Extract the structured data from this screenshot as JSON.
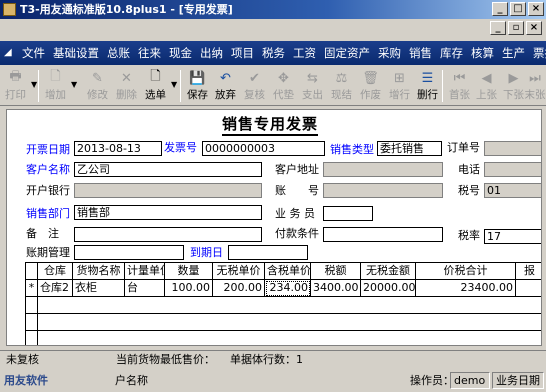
{
  "window": {
    "title": "T3-用友通标准版10.8plus1 - [专用发票]"
  },
  "menu": [
    "文件",
    "基础设置",
    "总账",
    "往来",
    "现金",
    "出纳",
    "项目",
    "税务",
    "工资",
    "固定资产",
    "采购",
    "销售",
    "库存",
    "核算",
    "生产",
    "票据"
  ],
  "toolbar": {
    "print": "打印",
    "add": "增加",
    "modify": "修改",
    "delete": "删除",
    "select_doc": "选单",
    "save": "保存",
    "abandon": "放弃",
    "review": "复核",
    "voucher": "代垫",
    "payment": "支出",
    "settle": "现结",
    "void": "作废",
    "add_row": "增行",
    "delete_row": "删行",
    "first": "首张",
    "prev": "上张",
    "next": "下张",
    "last": "末张"
  },
  "invoice": {
    "title": "销售专用发票",
    "date_label": "开票日期",
    "date_value": "2013-08-13",
    "invoice_no_label": "发票号",
    "invoice_no_value": "0000000003",
    "sales_type_label": "销售类型",
    "sales_type_value": "委托销售",
    "order_no_label": "订单号",
    "customer_label": "客户名称",
    "customer_value": "乙公司",
    "customer_addr_label": "客户地址",
    "phone_label": "电话",
    "bank_label": "开户银行",
    "account_label": "账　　号",
    "tax_no_label": "税号",
    "tax_no_value": "01",
    "dept_label": "销售部门",
    "dept_value": "销售部",
    "clerk_label": "业 务 员",
    "remark_label": "备　注",
    "payment_terms_label": "付款条件",
    "tax_rate_label": "税率",
    "tax_rate_value": "17",
    "account_mgmt_label": "账期管理",
    "due_date_label": "到期日"
  },
  "table": {
    "headers": [
      "仓库",
      "货物名称",
      "计量单位",
      "数量",
      "无税单价",
      "含税单价",
      "税额",
      "无税金额",
      "价税合计",
      "报"
    ],
    "rows": [
      {
        "marker": "*",
        "warehouse": "仓库2",
        "item": "衣柜",
        "unit": "台",
        "qty": "100.00",
        "price_no_tax": "200.00",
        "price_tax": "234.00",
        "tax": "3400.00",
        "amount_no_tax": "20000.00",
        "total": "23400.00"
      }
    ]
  },
  "status": {
    "review_status": "未复核",
    "lowest_price": "当前货物最低售价：",
    "row_count": "单据体行数：1",
    "company_label": "用友软件",
    "tree_label": "户名称",
    "operator_label": "操作员：",
    "operator_value": "demo (d",
    "business_date": "业务日期"
  },
  "colors": {
    "title_start": "#0a246a",
    "menu_bg": "#0a2a6e",
    "label_blue": "#0000ff"
  }
}
